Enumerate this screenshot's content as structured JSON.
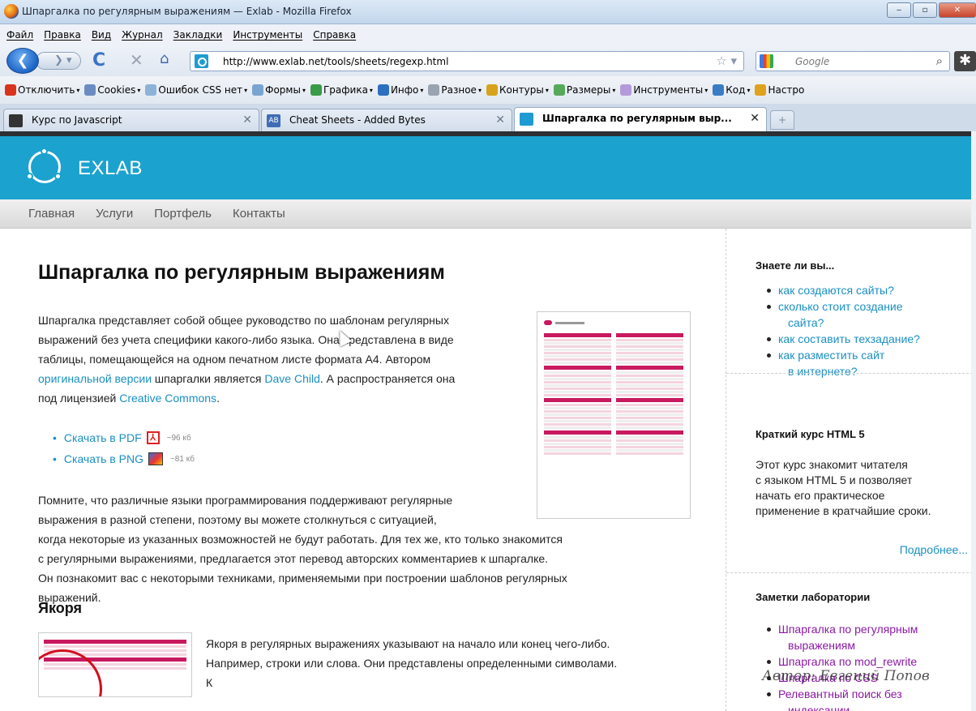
{
  "window": {
    "title": "Шпаргалка по регулярным выражениям — Exlab - Mozilla Firefox",
    "buttons": [
      "‒",
      "▫",
      "✕"
    ]
  },
  "menu": [
    "Файл",
    "Правка",
    "Вид",
    "Журнал",
    "Закладки",
    "Инструменты",
    "Справка"
  ],
  "nav": {
    "url": "http://www.exlab.net/tools/sheets/regexp.html",
    "search_placeholder": "Google",
    "back_glyph": "❮",
    "fwd_glyph": "❯ ▾",
    "reload_glyph": "C",
    "stop_glyph": "✕",
    "home_glyph": "⌂",
    "star_glyph": "☆ ▾",
    "search_glyph": "⌕"
  },
  "devbar": [
    {
      "label": "Отключить",
      "color": "#d9341b",
      "dd": "▾"
    },
    {
      "label": "Cookies",
      "color": "#6a8cc2",
      "dd": "▾"
    },
    {
      "label": "Ошибок CSS нет",
      "color": "#8db2d8",
      "dd": "▾"
    },
    {
      "label": "Формы",
      "color": "#7aa4d0",
      "dd": "▾"
    },
    {
      "label": "Графика",
      "color": "#3a9a48",
      "dd": "▾"
    },
    {
      "label": "Инфо",
      "color": "#2d6fbf",
      "dd": "▾"
    },
    {
      "label": "Разное",
      "color": "#9aa4b1",
      "dd": "▾"
    },
    {
      "label": "Контуры",
      "color": "#d6a31a",
      "dd": "▾"
    },
    {
      "label": "Размеры",
      "color": "#57a85a",
      "dd": "▾"
    },
    {
      "label": "Инструменты",
      "color": "#b39ad8",
      "dd": "▾"
    },
    {
      "label": "Код",
      "color": "#3a7cc4",
      "dd": "▾"
    },
    {
      "label": "Настро",
      "color": "#e0a21c",
      "dd": ""
    }
  ],
  "tabs": [
    {
      "label": "Курс по Javascript",
      "icon_color": "#333",
      "close": "✕"
    },
    {
      "label": "Cheat Sheets - Added Bytes",
      "icon_color": "#3f6cb5",
      "close": "✕"
    },
    {
      "label": "Шпаргалка по регулярным выр...",
      "icon_color": "#1f9bd3",
      "close": "✕"
    }
  ],
  "newtab": "+",
  "site": {
    "logo": "EXLAB",
    "nav": [
      "Главная",
      "Услуги",
      "Портфель",
      "Контакты"
    ]
  },
  "article": {
    "title": "Шпаргалка по регулярным выражениям",
    "p1": {
      "lines": [
        "Шпаргалка представляет собой общее руководство по шаблонам регулярных",
        "выражений без учета специфики какого-либо языка. Она представлена в виде",
        "таблицы, помещающейся на одном печатном листе формата А4. Автором"
      ],
      "l4_link1": "оригинальной версии",
      "l4_mid": " шпаргалки является ",
      "l4_link2": "Dave Child",
      "l4_tail": ". А распространяется она",
      "l5_pre": "под лицензией ",
      "l5_link": "Creative Commons",
      "l5_tail": "."
    },
    "downloads": [
      {
        "label": "Скачать в PDF",
        "size": "~96 кб",
        "icon": "pdf"
      },
      {
        "label": "Скачать в PNG",
        "size": "~81 кб",
        "icon": "png"
      }
    ],
    "p2": [
      "Помните, что различные языки программирования поддерживают регулярные",
      "выражения в разной степени, поэтому вы можете столкнуться с ситуацией,",
      "когда некоторые из указанных возможностей не будут работать. Для тех же, кто только знакомится",
      "с регулярными выражениями, предлагается этот перевод авторских комментариев к шпаргалке.",
      "Он познакомит вас с некоторыми техниками, применяемыми при построении шаблонов регулярных",
      "выражений."
    ],
    "section_title": "Якоря",
    "section_p": [
      "Якоря в регулярных выражениях указывают на начало или конец чего-либо.",
      "Например, строки или слова. Они представлены определенными символами.",
      "К"
    ],
    "pdf_icon_glyph": "⅄"
  },
  "sidebar": {
    "did_you_know": {
      "title": "Знаете ли вы...",
      "items": [
        {
          "lines": [
            "как создаются сайты?"
          ]
        },
        {
          "lines": [
            "сколько стоит создание",
            "сайта?"
          ]
        },
        {
          "lines": [
            "как составить техзадание?"
          ]
        },
        {
          "lines": [
            "как разместить сайт",
            "в интернете?"
          ]
        }
      ]
    },
    "course": {
      "title": "Краткий курс HTML 5",
      "text": [
        "Этот курс знакомит читателя",
        "с языком HTML 5 и позволяет",
        "начать его практическое",
        "применение в кратчайшие сроки."
      ],
      "more": "Подробнее..."
    },
    "notes": {
      "title": "Заметки лаборатории",
      "items": [
        {
          "lines": [
            "Шпаргалка по регулярным",
            "выражениям"
          ]
        },
        {
          "lines": [
            "Шпаргалка по mod_rewrite"
          ]
        },
        {
          "lines": [
            "Шпаргалка по CSS"
          ]
        },
        {
          "lines": [
            "Релевантный поиск без",
            "индексации"
          ]
        }
      ]
    }
  },
  "watermark": "Автор: Евгений Попов"
}
